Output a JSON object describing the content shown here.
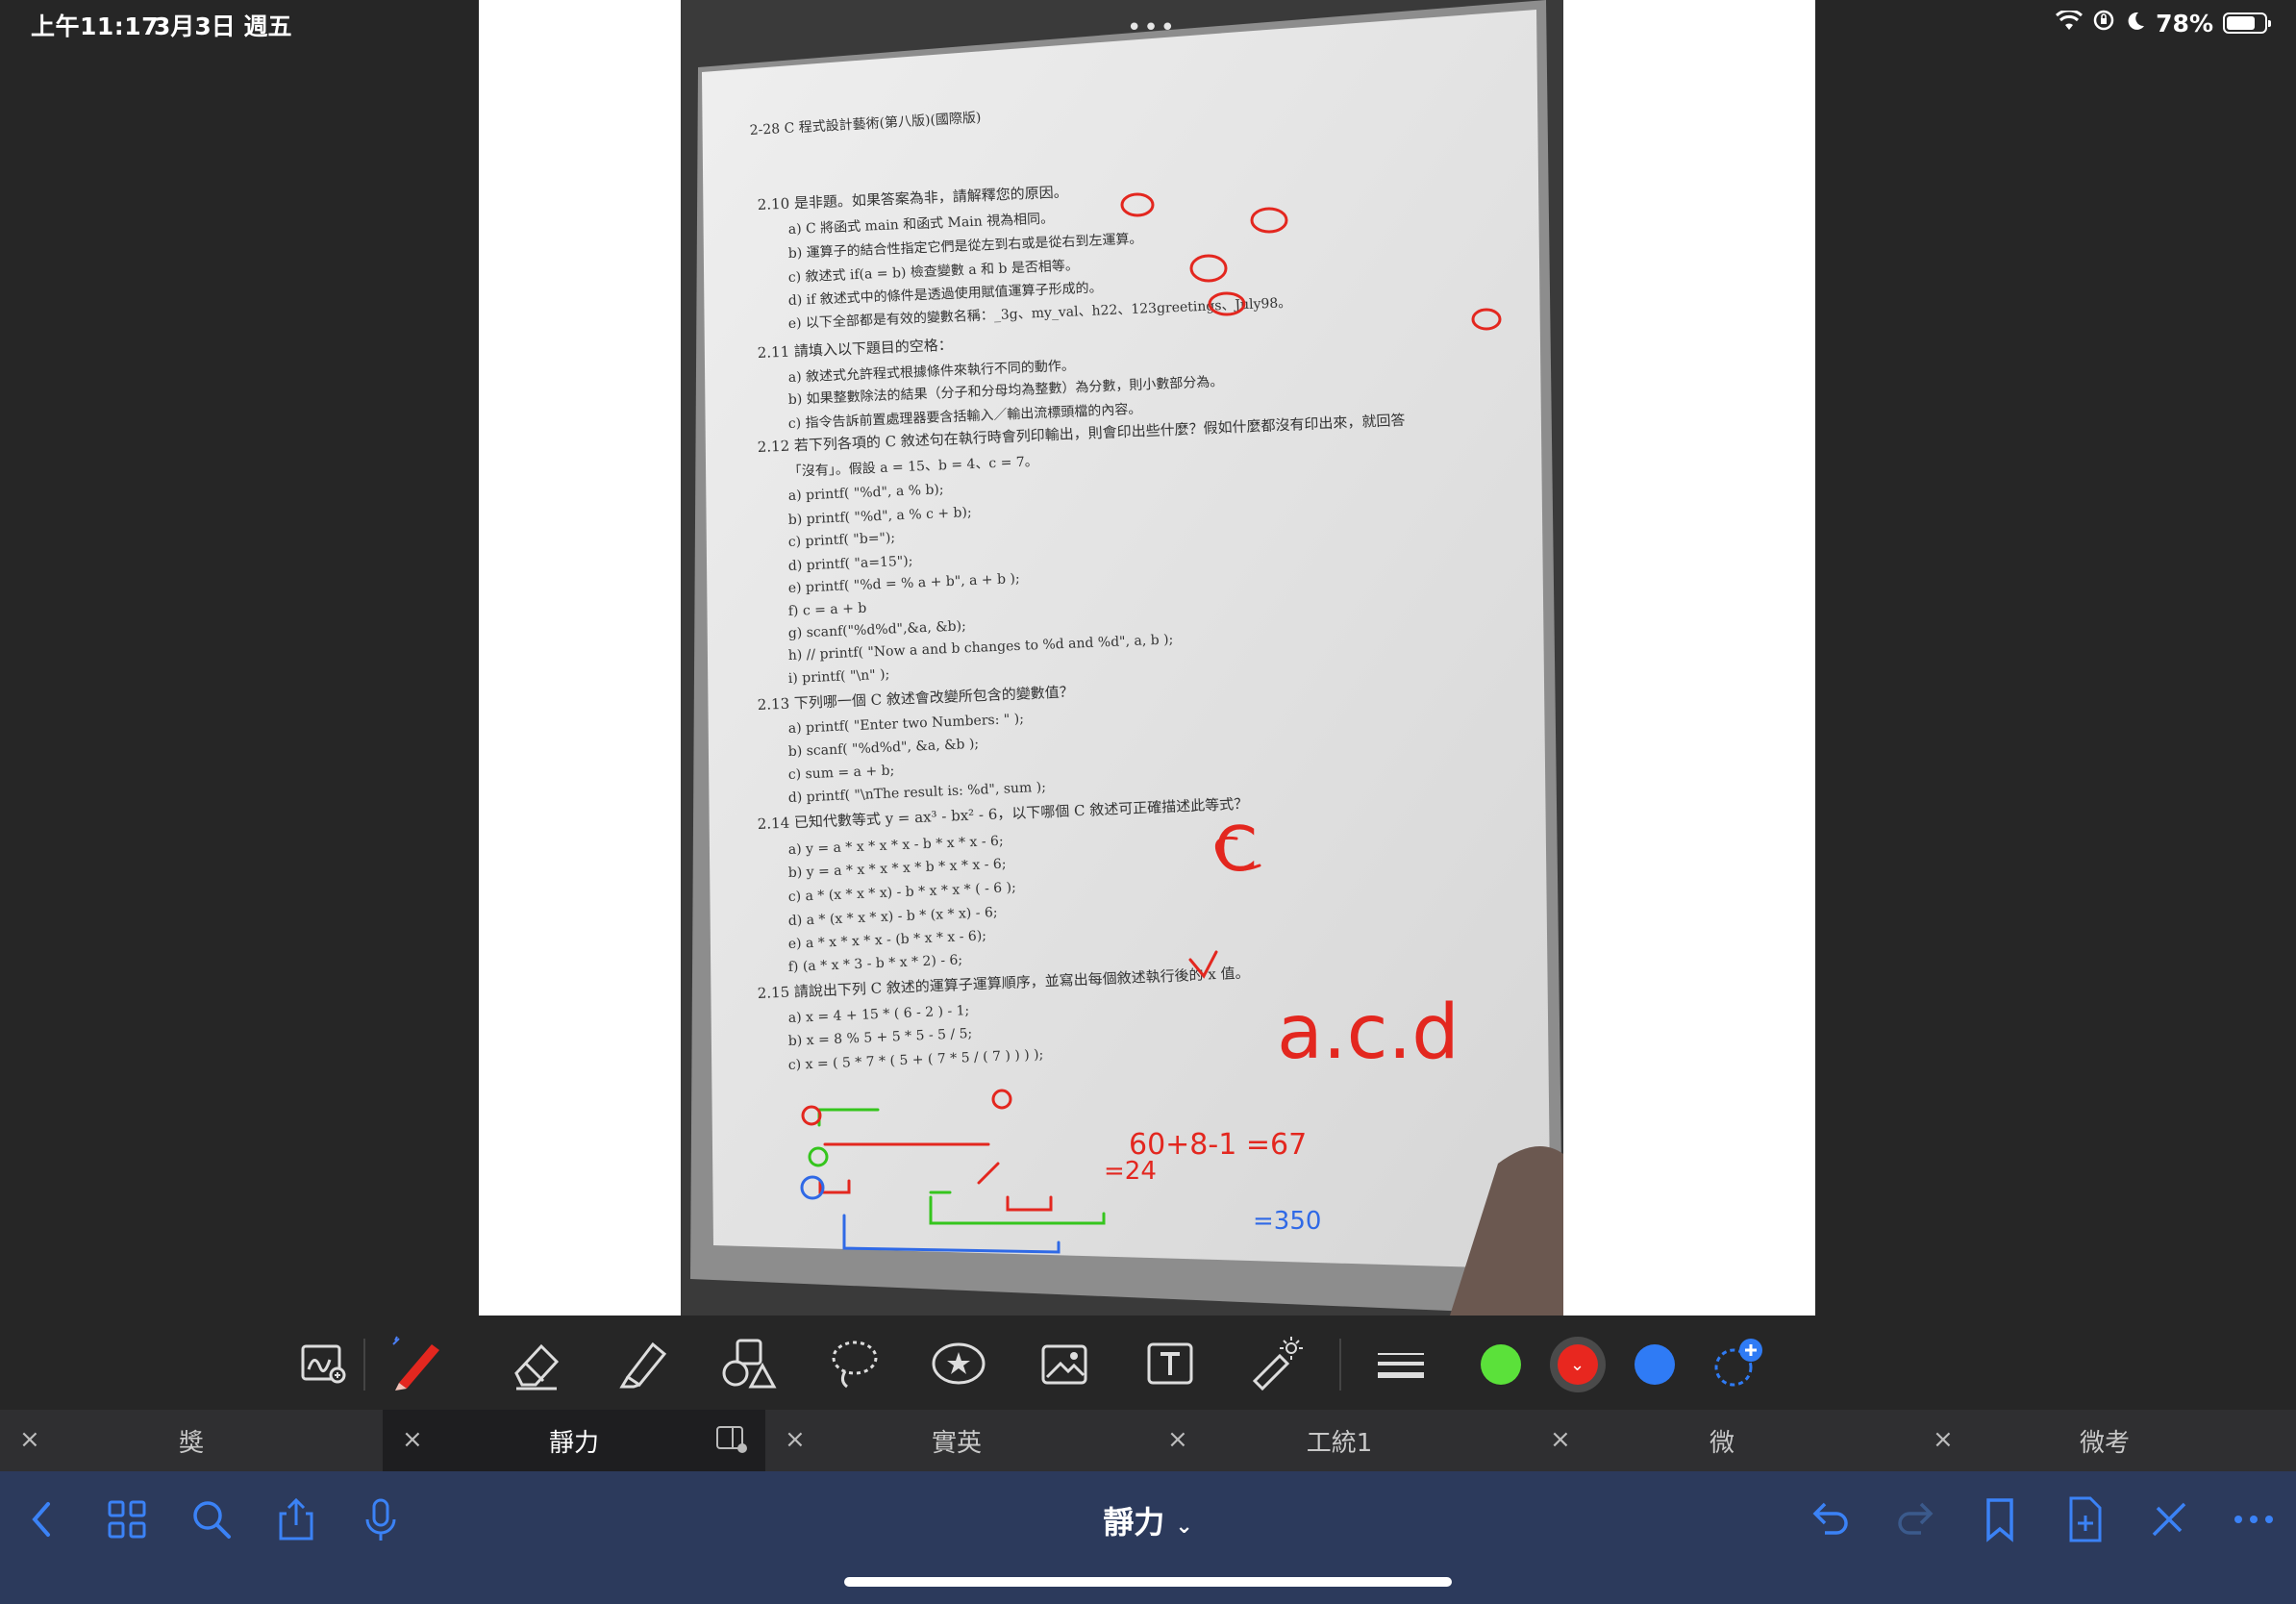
{
  "status_bar": {
    "time": "上午11:17",
    "date": "3月3日 週五",
    "battery": "78%",
    "battery_level": 0.78
  },
  "document": {
    "header": "2-28  C 程式設計藝術(第八版)(國際版)",
    "lines": [
      "2.10 是非題。如果答案為非，請解釋您的原因。",
      "a)  C 將函式 main 和函式 Main 視為相同。",
      "b)  運算子的結合性指定它們是從左到右或是從右到左運算。",
      "c)  敘述式 if(a = b) 檢查變數 a 和 b 是否相等。",
      "d)  if 敘述式中的條件是透過使用賦值運算子形成的。",
      "e)  以下全部都是有效的變數名稱：_3g、my_val、h22、123greetings、July98。",
      "2.11 請填入以下題目的空格：",
      "a)  敘述式允許程式根據條件來執行不同的動作。",
      "b)  如果整數除法的結果（分子和分母均為整數）為分數，則小數部分為。",
      "c)  指令告訴前置處理器要含括輸入／輸出流標頭檔的內容。",
      "2.12 若下列各項的 C 敘述句在執行時會列印輸出，則會印出些什麼？假如什麼都沒有印出來，就回答",
      "「沒有」。假設 a = 15、b = 4、c = 7。",
      "a)  printf( \"%d\", a % b);",
      "b)  printf( \"%d\", a % c + b);",
      "c)  printf( \"b=\");",
      "d)  printf( \"a=15\");",
      "e)  printf( \"%d = % a + b\", a + b );",
      "f)  c = a + b",
      "g)  scanf(\"%d%d\",&a, &b);",
      "h)  // printf( \"Now a and b changes to %d and %d\", a, b );",
      "i)  printf( \"\\n\" );",
      "2.13 下列哪一個 C 敘述會改變所包含的變數值？",
      "a)  printf( \"Enter two Numbers: \" );",
      "b)  scanf( \"%d%d\", &a, &b );",
      "c)  sum = a + b;",
      "d)  printf( \"\\nThe result is: %d\", sum );",
      "2.14 已知代數等式 y = ax³ - bx² - 6，以下哪個 C 敘述可正確描述此等式？",
      "a)  y = a * x * x * x - b * x * x - 6;",
      "b)  y = a * x * x * x * b * x * x - 6;",
      "c)  a * (x * x * x) - b * x * x * ( - 6 );",
      "d)  a * (x * x * x) - b * (x * x) - 6;",
      "e)  a * x * x * x - (b * x * x - 6);",
      "f)  (a * x * 3 - b * x * 2) - 6;",
      "2.15 請說出下列 C 敘述的運算子運算順序，並寫出每個敘述執行後的 x 值。",
      "a)  x = 4 + 15 * ( 6 - 2 ) - 1;",
      "b)  x = 8 % 5 + 5 * 5 - 5 / 5;",
      "c)  x = ( 5 * 7 * ( 5 + ( 7 * 5 / ( 7 ) ) ) );"
    ],
    "annotations": {
      "answer_2_13": "C",
      "answer_2_14": "a.c.d",
      "calc_a": "60+8-1 =67",
      "calc_b": "=24",
      "calc_c": "=350"
    }
  },
  "toolbar": {
    "tools": [
      "lasso-zoom-icon",
      "pen-icon",
      "eraser-icon",
      "highlighter-icon",
      "shapes-icon",
      "lasso-icon",
      "sticker-icon",
      "image-icon",
      "text-icon",
      "laser-pointer-icon",
      "line-width-icon"
    ],
    "colors": [
      "#5be13a",
      "#e8271f",
      "#2f7bf5"
    ],
    "selected_color": "#e8271f"
  },
  "tabs": [
    {
      "label": "獎",
      "active": false
    },
    {
      "label": "靜力",
      "active": true
    },
    {
      "label": "實英",
      "active": false
    },
    {
      "label": "工統1",
      "active": false
    },
    {
      "label": "微",
      "active": false
    },
    {
      "label": "微考",
      "active": false
    }
  ],
  "nav": {
    "title": "靜力",
    "title_chevron": "⌄"
  }
}
